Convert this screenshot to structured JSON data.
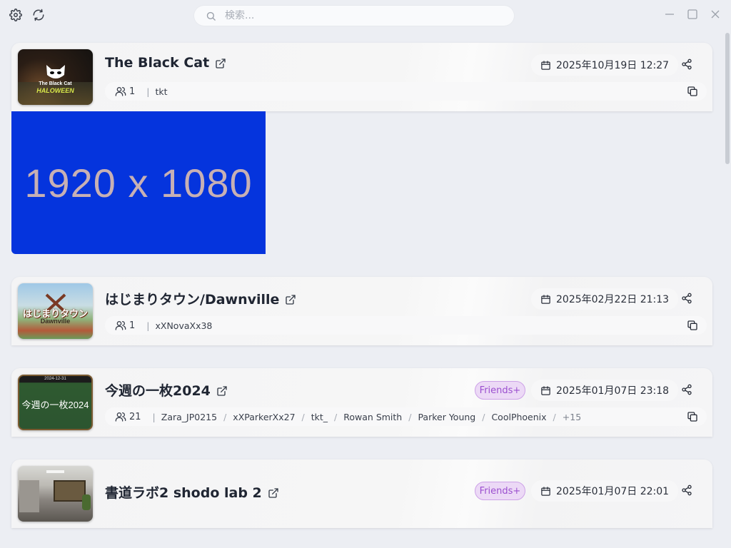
{
  "search": {
    "placeholder": "検索..."
  },
  "scrollbar_position": 0.0,
  "preview": {
    "label": "1920 x 1080"
  },
  "cards": [
    {
      "title": "The Black Cat",
      "date": "2025年10月19日 12:27",
      "user_count": "1",
      "users": [
        "tkt"
      ],
      "thumb_lines": [
        "The Black Cat",
        "HALOWEEN"
      ]
    },
    {
      "title": "はじまりタウン/Dawnville",
      "date": "2025年02月22日 21:13",
      "user_count": "1",
      "users": [
        "xXNovaXx38"
      ],
      "thumb_lines": [
        "はじまりタウン",
        "Dawnville"
      ]
    },
    {
      "title": "今週の一枚2024",
      "badge": "Friends+",
      "date": "2025年01月07日 23:18",
      "user_count": "21",
      "users": [
        "Zara_JP0215",
        "xXParkerXx27",
        "tkt_",
        "Rowan Smith",
        "Parker Young",
        "CoolPhoenix"
      ],
      "more": "+15",
      "thumb_lines": [
        "2024-12-31",
        "今週の一枚2024"
      ]
    },
    {
      "title": "書道ラボ2 shodo lab 2",
      "badge": "Friends+",
      "date": "2025年01月07日 22:01"
    }
  ],
  "colors": {
    "accent_purple": "#9b4fcf",
    "preview_blue": "#0534dd",
    "background": "#eceef3"
  }
}
